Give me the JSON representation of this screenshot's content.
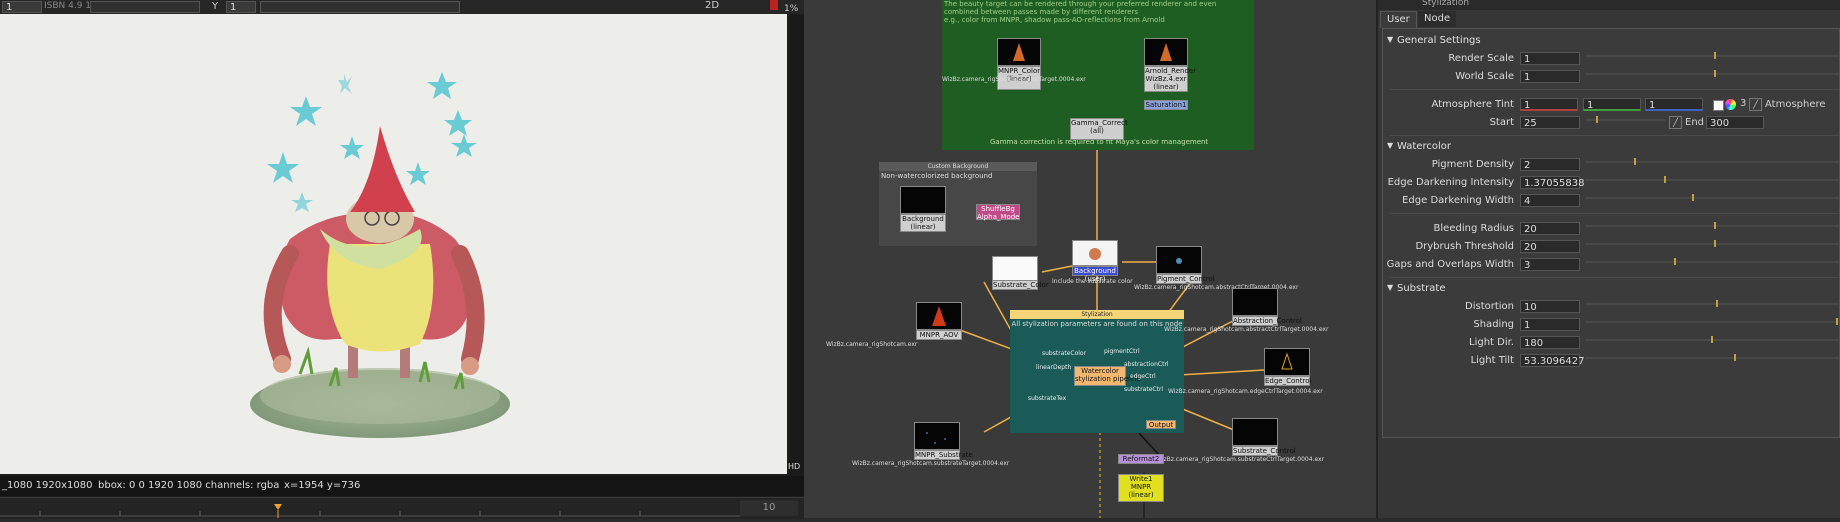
{
  "viewer": {
    "frame_field": "1",
    "top_left_text": "1",
    "y_label": "Y",
    "y_value": "1",
    "zoom_label": "2D",
    "zoom_percent": "1%",
    "hud": {
      "format": "_1080 1920x1080",
      "bbox": "bbox: 0 0 1920 1080 channels: rgba",
      "coords": "x=1954 y=736",
      "hd_badge": "HD"
    },
    "timeline_end": "10"
  },
  "graph": {
    "top_backdrop_text": "The beauty target can be rendered through your preferred renderer and even combined between passes made by different renderers\ne.g., color from MNPR, shadow pass-AO-reflections from Arnold",
    "gamma_caption": "Gamma correction is required to fit Maya's color management",
    "bg_backdrop_title": "Custom Background",
    "bg_backdrop_text": "Non-watercolorized background",
    "stylization_title": "Stylization",
    "stylization_text": "All stylization parameters are found on this node",
    "nodes": {
      "mnpr_color": "MNPR_Color\n(linear)",
      "arnold_render": "Arnold_Render\nWizBz.4.exr\n(linear)",
      "saturation": "Saturation1",
      "gamma_correct": "Gamma_Correct\n(all)",
      "background_left": "Background\n(linear)",
      "shuffle": "ShuffleBg\nAlpha_Mode",
      "substrate_color": "Substrate_Color",
      "background_sel": "Background (user)",
      "pigment_control": "Pigment_Control",
      "mnpr_aov": "MNPR_AOV",
      "abstraction_control": "Abstraction_Control",
      "watercolor": "Watercolor\nstylization pipeline",
      "edge_control": "Edge_Control",
      "output": "Output",
      "mnpr_substrate": "MNPR_Substrate",
      "substrate_control": "Substrate_Control",
      "reformat": "Reformat2",
      "write": "Write1\nMNPR\n(linear)"
    },
    "file_labels": {
      "color": "WizBz.camera_rigShotcam.colorTarget.0004.exr",
      "aov": "WizBz.camera_rigShotcam.exr",
      "substrate": "WizBz.camera_rigShotcam.substrateTarget.0004.exr",
      "pigment": "WizBz.camera_rigShotcam.abstractCtrlTarget.0004.exr",
      "abstraction": "WizBz.camera_rigShotcam.abstractCtrlTarget.0004.exr",
      "edge": "WizBz.camera_rigShotcam.edgeCtrlTarget.0004.exr",
      "substrate_ctrl": "WizBz.camera_rigShotcam.substrateCtrlTarget.0004.exr",
      "bg_note": "Include the substrate color"
    },
    "inputs": {
      "substrateColor": "substrateColor",
      "pigmentCtrl": "pigmentCtrl",
      "linearDepth": "linearDepth",
      "abstractionCtrl": "abstractionCtrl",
      "edgeCtrl": "edgeCtrl",
      "substrateCtrl": "substrateCtrl",
      "substrateTex": "substrateTex"
    }
  },
  "props": {
    "title": "Stylization",
    "tabs": [
      "User",
      "Node"
    ],
    "general_settings": "General Settings",
    "watercolor": "Watercolor",
    "substrate": "Substrate",
    "params": {
      "render_scale": {
        "label": "Render Scale",
        "value": "1"
      },
      "world_scale": {
        "label": "World Scale",
        "value": "1"
      },
      "atmosphere_tint": {
        "label": "Atmosphere Tint",
        "r": "1",
        "g": "1",
        "b": "1",
        "channels": "3",
        "atm_label": "Atmosphere"
      },
      "start": {
        "label": "Start",
        "value": "25",
        "end_label": "End",
        "end_value": "300"
      },
      "pigment_density": {
        "label": "Pigment Density",
        "value": "2"
      },
      "edge_darkening_intensity": {
        "label": "Edge Darkening Intensity",
        "value": "1.37055838"
      },
      "edge_darkening_width": {
        "label": "Edge Darkening Width",
        "value": "4"
      },
      "bleeding_radius": {
        "label": "Bleeding Radius",
        "value": "20"
      },
      "drybrush_threshold": {
        "label": "Drybrush Threshold",
        "value": "20"
      },
      "gaps_overlaps_width": {
        "label": "Gaps and Overlaps Width",
        "value": "3"
      },
      "distortion": {
        "label": "Distortion",
        "value": "10"
      },
      "shading": {
        "label": "Shading",
        "value": "1"
      },
      "light_dir": {
        "label": "Light Dir.",
        "value": "180"
      },
      "light_tilt": {
        "label": "Light Tilt",
        "value": "53.3096427"
      }
    }
  },
  "colors": {
    "backdrop_green": "#1f5e23",
    "backdrop_teal": "#1a5a57",
    "link_orange": "#f0b048",
    "stylize_header": "#f6d579"
  }
}
